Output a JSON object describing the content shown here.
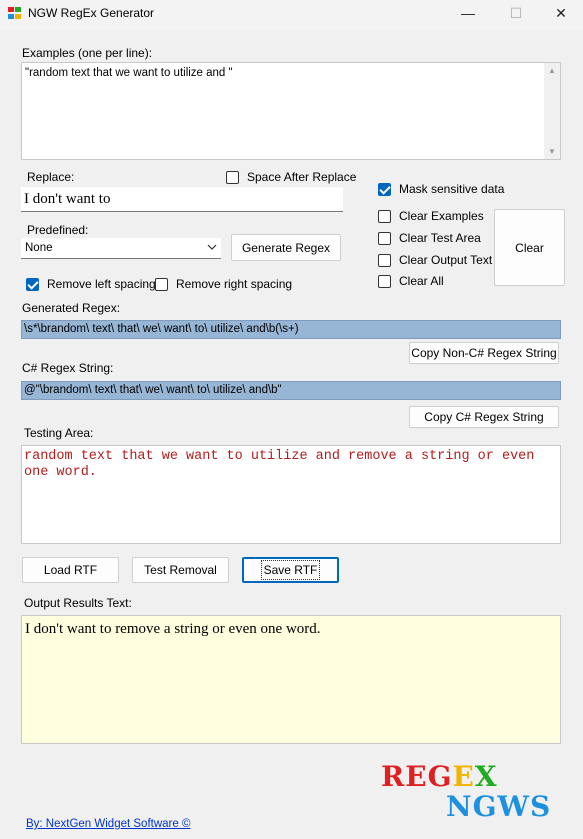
{
  "window": {
    "title": "NGW RegEx Generator",
    "controls": {
      "minimize": "—",
      "maximize": "☐",
      "close": "✕"
    }
  },
  "examples": {
    "label": "Examples (one per line):",
    "value": "\"random text that we want to utilize and \""
  },
  "replace": {
    "label": "Replace:",
    "value": "I don't want to",
    "space_after_label": "Space After Replace",
    "space_after_checked": false
  },
  "options": {
    "mask_label": "Mask sensitive data",
    "mask_checked": true,
    "clear_examples_label": "Clear Examples",
    "clear_test_area_label": "Clear Test Area",
    "clear_output_text_label": "Clear Output Text",
    "clear_all_label": "Clear All",
    "clear_button": "Clear"
  },
  "predefined": {
    "label": "Predefined:",
    "selected": "None"
  },
  "generate_button": "Generate Regex",
  "spacing": {
    "remove_left_label": "Remove left spacing",
    "remove_left_checked": true,
    "remove_right_label": "Remove right spacing",
    "remove_right_checked": false
  },
  "generated": {
    "label": "Generated Regex:",
    "value": "\\s*\\brandom\\ text\\ that\\ we\\ want\\ to\\ utilize\\ and\\b(\\s+)",
    "copy_button": "Copy Non-C# Regex String"
  },
  "csharp": {
    "label": "C# Regex String:",
    "value": "@\"\\brandom\\ text\\ that\\ we\\ want\\ to\\ utilize\\ and\\b\"",
    "copy_button": "Copy C# Regex String"
  },
  "testing": {
    "label": "Testing Area:",
    "value": "random text that we want to utilize and remove a string or even one word."
  },
  "actions": {
    "load": "Load RTF",
    "test": "Test Removal",
    "save": "Save RTF"
  },
  "output": {
    "label": "Output Results Text:",
    "value": "I don't want to remove a string or even one word."
  },
  "logo": {
    "regex_letters": [
      "R",
      "E",
      "G",
      "E",
      "X"
    ],
    "regex_colors": [
      "#e02020",
      "#e02020",
      "#e02020",
      "#f0b400",
      "#22aa22"
    ],
    "ngws": "NGWS"
  },
  "footer": {
    "link": "By: NextGen Widget Software  ©"
  }
}
